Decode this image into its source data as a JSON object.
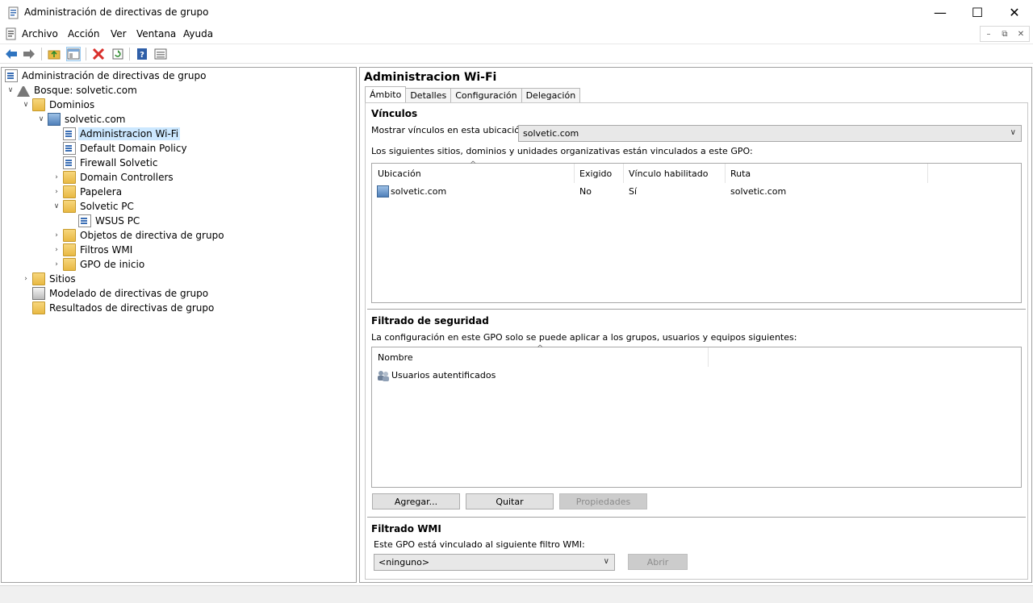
{
  "window": {
    "title": "Administración de directivas de grupo",
    "minimize": "—",
    "maximize": "☐",
    "close": "✕"
  },
  "menu": [
    "Archivo",
    "Acción",
    "Ver",
    "Ventana",
    "Ayuda"
  ],
  "mdi_buttons": [
    "–",
    "⧉",
    "✕"
  ],
  "toolbar": {
    "icons": [
      "back-arrow-icon",
      "forward-arrow-icon",
      "up-folder-icon",
      "show-hide-tree-icon",
      "delete-icon",
      "refresh-icon",
      "help-icon",
      "properties-icon"
    ]
  },
  "tree": {
    "root": "Administración de directivas de grupo",
    "forest": "Bosque: solvetic.com",
    "domains": "Dominios",
    "domain": "solvetic.com",
    "gpo_wifi": "Administracion Wi-Fi",
    "gpo_default": "Default Domain Policy",
    "gpo_firewall": "Firewall Solvetic",
    "ou_dc": "Domain Controllers",
    "ou_papelera": "Papelera",
    "ou_solvetic_pc": "Solvetic PC",
    "gpo_wsus": "WSUS PC",
    "gpo_objects": "Objetos de directiva de grupo",
    "wmi_filters": "Filtros WMI",
    "starter_gpos": "GPO de inicio",
    "sites": "Sitios",
    "modeling": "Modelado de directivas de grupo",
    "results": "Resultados de directivas de grupo"
  },
  "details": {
    "title": "Administracion Wi-Fi",
    "tabs": [
      "Ámbito",
      "Detalles",
      "Configuración",
      "Delegación"
    ],
    "links": {
      "heading": "Vínculos",
      "show_label": "Mostrar vínculos en esta ubicación:",
      "location_value": "solvetic.com",
      "desc": "Los siguientes sitios, dominios y unidades organizativas están vinculados a este GPO:",
      "columns": [
        "Ubicación",
        "Exigido",
        "Vínculo habilitado",
        "Ruta"
      ],
      "rows": [
        {
          "location": "solvetic.com",
          "enforced": "No",
          "enabled": "Sí",
          "path": "solvetic.com"
        }
      ]
    },
    "security": {
      "heading": "Filtrado de seguridad",
      "desc": "La configuración en este GPO solo se puede aplicar a los grupos, usuarios y equipos siguientes:",
      "column": "Nombre",
      "rows": [
        "Usuarios autentificados"
      ],
      "add": "Agregar...",
      "remove": "Quitar",
      "properties": "Propiedades"
    },
    "wmi": {
      "heading": "Filtrado WMI",
      "desc": "Este GPO está vinculado al siguiente filtro WMI:",
      "value": "<ninguno>",
      "open": "Abrir"
    }
  }
}
